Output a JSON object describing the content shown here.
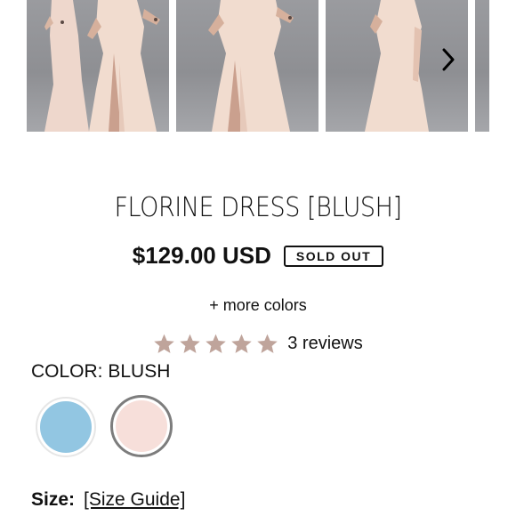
{
  "gallery": {
    "images": [
      "dress-photo-1",
      "dress-photo-2",
      "dress-photo-3",
      "dress-photo-4"
    ],
    "next_icon": "chevron-right-icon"
  },
  "product": {
    "title": "FLORINE DRESS [BLUSH]",
    "price": "$129.00 USD",
    "badge": "SOLD OUT",
    "more_colors": "+ more colors"
  },
  "rating": {
    "stars": 5,
    "star_color": "#bfa49b",
    "reviews_text": "3 reviews"
  },
  "color": {
    "label": "COLOR: BLUSH",
    "swatches": [
      {
        "name": "blue",
        "hex": "#92c6e2",
        "selected": false
      },
      {
        "name": "blush",
        "hex": "#f7dfda",
        "selected": true
      }
    ]
  },
  "size": {
    "label": "Size:",
    "guide_link": "[Size Guide]"
  }
}
